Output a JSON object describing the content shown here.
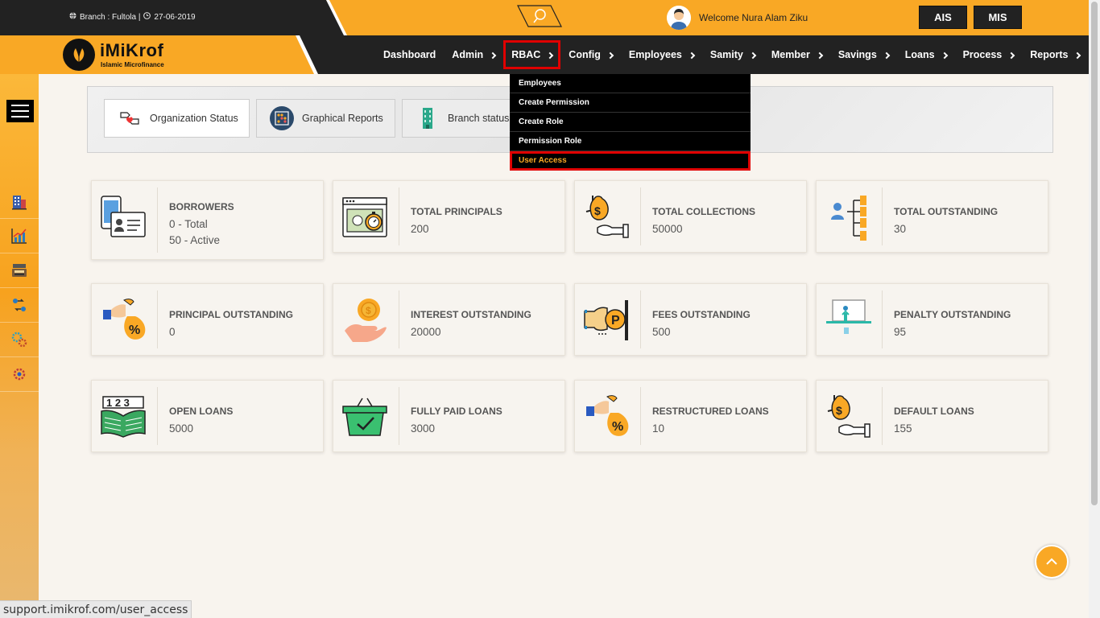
{
  "topbar": {
    "branch": "Branch : Fultola |",
    "date": "27-06-2019",
    "welcome": "Welcome Nura Alam Ziku",
    "buttons": [
      "AIS",
      "MIS"
    ]
  },
  "logo": {
    "name": "iMiKrof",
    "tagline": "Islamic Microfinance"
  },
  "nav": {
    "items": [
      {
        "label": "Dashboard",
        "chevron": false
      },
      {
        "label": "Admin",
        "chevron": true
      },
      {
        "label": "RBAC",
        "chevron": true
      },
      {
        "label": "Config",
        "chevron": true
      },
      {
        "label": "Employees",
        "chevron": true
      },
      {
        "label": "Samity",
        "chevron": true
      },
      {
        "label": "Member",
        "chevron": true
      },
      {
        "label": "Savings",
        "chevron": true
      },
      {
        "label": "Loans",
        "chevron": true
      },
      {
        "label": "Process",
        "chevron": true
      },
      {
        "label": "Reports",
        "chevron": true
      }
    ],
    "active": "RBAC"
  },
  "dropdown": {
    "items": [
      "Employees",
      "Create Permission",
      "Create Role",
      "Permission Role",
      "User Access"
    ],
    "highlighted": "User Access"
  },
  "sidebar": {
    "icons": [
      "building-icon",
      "chart-growth-icon",
      "cash-register-icon",
      "transfer-icon",
      "gears-icon",
      "settings-icon"
    ]
  },
  "tabs": [
    {
      "label": "Organization Status",
      "icon": "handshake-heart-icon",
      "selected": true
    },
    {
      "label": "Graphical Reports",
      "icon": "abacus-icon",
      "selected": false
    },
    {
      "label": "Branch status",
      "icon": "office-building-icon",
      "selected": false
    }
  ],
  "cards": [
    {
      "title": "BORROWERS",
      "lines": [
        "0 - Total",
        "50 - Active"
      ],
      "icon": "phone-id-card-icon"
    },
    {
      "title": "TOTAL PRINCIPALS",
      "lines": [
        "200"
      ],
      "icon": "stopwatch-card-icon"
    },
    {
      "title": "TOTAL COLLECTIONS",
      "lines": [
        "50000"
      ],
      "icon": "money-bag-hand-icon"
    },
    {
      "title": "TOTAL OUTSTANDING",
      "lines": [
        "30"
      ],
      "icon": "hierarchy-icon"
    },
    {
      "title": "PRINCIPAL OUTSTANDING",
      "lines": [
        "0"
      ],
      "icon": "percent-bag-icon"
    },
    {
      "title": "INTEREST OUTSTANDING",
      "lines": [
        "20000"
      ],
      "icon": "coin-hand-icon"
    },
    {
      "title": "FEES OUTSTANDING",
      "lines": [
        "500"
      ],
      "icon": "parking-coin-icon"
    },
    {
      "title": "PENALTY OUTSTANDING",
      "lines": [
        "95"
      ],
      "icon": "presentation-board-icon"
    },
    {
      "title": "OPEN LOANS",
      "lines": [
        "5000"
      ],
      "icon": "open-book-123-icon"
    },
    {
      "title": "FULLY PAID LOANS",
      "lines": [
        "3000"
      ],
      "icon": "basket-check-icon"
    },
    {
      "title": "RESTRUCTURED LOANS",
      "lines": [
        "10"
      ],
      "icon": "percent-bag-icon"
    },
    {
      "title": "DEFAULT LOANS",
      "lines": [
        "155"
      ],
      "icon": "money-bag-hand-icon"
    }
  ],
  "status_bar": {
    "url": "support.imikrof.com/user_access"
  },
  "colors": {
    "accent": "#f9a825",
    "dark": "#222222",
    "highlight": "#e00000"
  }
}
